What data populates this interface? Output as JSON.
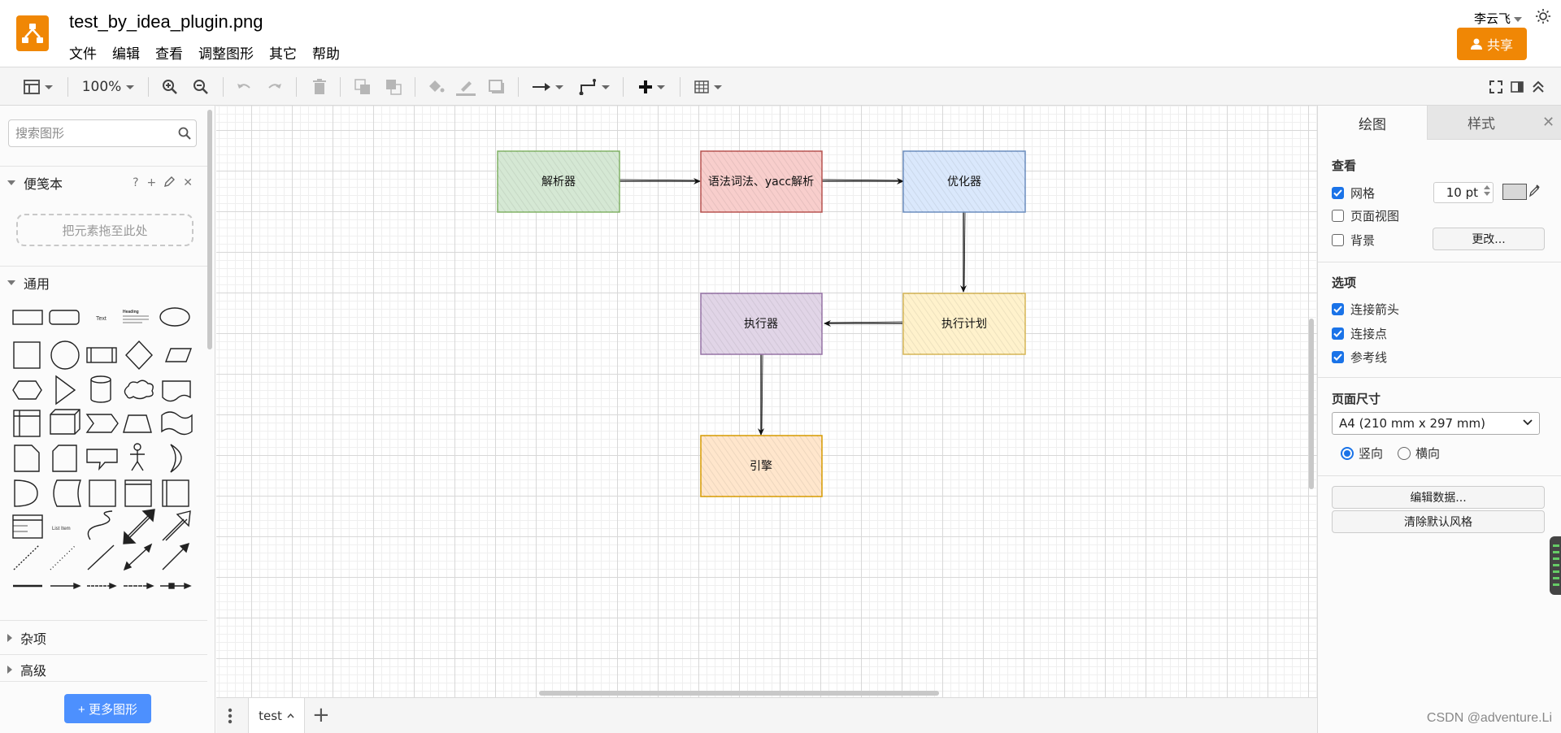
{
  "header": {
    "doc_title": "test_by_idea_plugin.png",
    "menu": [
      "文件",
      "编辑",
      "查看",
      "调整图形",
      "其它",
      "帮助"
    ],
    "user_name": "李云飞",
    "share_label": "共享"
  },
  "toolbar": {
    "zoom": "100%"
  },
  "sidebar": {
    "search_placeholder": "搜索图形",
    "scratchpad_title": "便笺本",
    "scratchpad_help": "?",
    "drop_hint": "把元素拖至此处",
    "general_title": "通用",
    "misc_title": "杂项",
    "advanced_title": "高级",
    "more_shapes": "+ 更多图形",
    "shape_text_label": "Text",
    "shape_heading_label": "Heading",
    "shape_list_item_label": "List Item"
  },
  "diagram": {
    "nodes": [
      {
        "id": "parser",
        "label": "解析器",
        "fill": "#d5e8d4",
        "stroke": "#82b366"
      },
      {
        "id": "syntax",
        "label": "语法词法、yacc解析",
        "fill": "#f8cecc",
        "stroke": "#b85450"
      },
      {
        "id": "optimizer",
        "label": "优化器",
        "fill": "#dae8fc",
        "stroke": "#6c8ebf"
      },
      {
        "id": "plan",
        "label": "执行计划",
        "fill": "#fff2cc",
        "stroke": "#d6b656"
      },
      {
        "id": "executor",
        "label": "执行器",
        "fill": "#e1d5e7",
        "stroke": "#9673a6"
      },
      {
        "id": "engine",
        "label": "引擎",
        "fill": "#ffe6cc",
        "stroke": "#d79b00"
      }
    ]
  },
  "pages": {
    "current": "test"
  },
  "format_panel": {
    "tab_diagram": "绘图",
    "tab_style": "样式",
    "view_title": "查看",
    "grid_label": "网格",
    "grid_size": "10 pt",
    "page_view_label": "页面视图",
    "background_label": "背景",
    "change_button": "更改...",
    "options_title": "选项",
    "connection_arrows": "连接箭头",
    "connection_points": "连接点",
    "guides": "参考线",
    "page_size_title": "页面尺寸",
    "page_size_value": "A4 (210 mm x 297 mm)",
    "portrait": "竖向",
    "landscape": "横向",
    "edit_data": "编辑数据...",
    "clear_style": "清除默认风格"
  },
  "watermark": "CSDN @adventure.Li",
  "colors": {
    "accent": "#f08705",
    "blue_button": "#4d90fe",
    "checkbox": "#1a73e8"
  }
}
